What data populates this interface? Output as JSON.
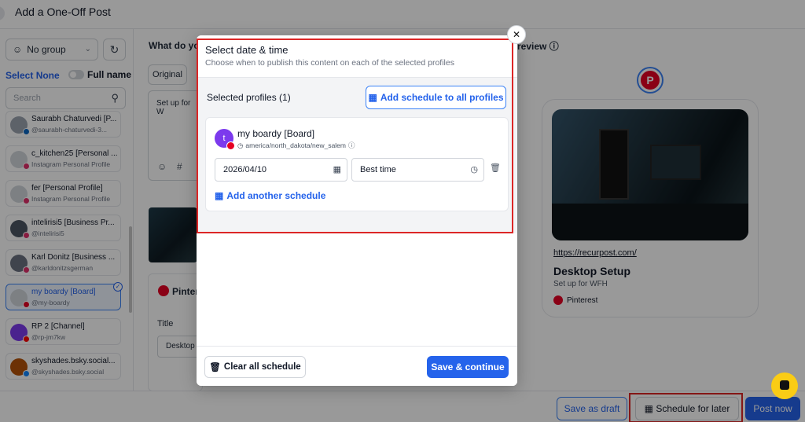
{
  "header": {
    "title": "Add a One-Off Post"
  },
  "sidebar": {
    "group_select": "No group",
    "select_none": "Select None",
    "full_name": "Full name",
    "search_placeholder": "Search",
    "profiles": [
      {
        "name": "Saurabh Chaturvedi [P...",
        "sub": "@saurabh-chaturvedi-3..."
      },
      {
        "name": "c_kitchen25 [Personal ...",
        "sub": "Instagram Personal Profile"
      },
      {
        "name": "fer [Personal Profile]",
        "sub": "Instagram Personal Profile"
      },
      {
        "name": "intelirisi5 [Business Pr...",
        "sub": "@intelirisi5"
      },
      {
        "name": "Karl Donitz [Business ...",
        "sub": "@karldonitzsgerman"
      },
      {
        "name": "my boardy [Board]",
        "sub": "@my-boardy"
      },
      {
        "name": "RP 2 [Channel]",
        "sub": "@rp-jm7kw"
      },
      {
        "name": "skyshades.bsky.social...",
        "sub": "@skyshades.bsky.social"
      }
    ]
  },
  "editor": {
    "label": "What do yo",
    "tab_original": "Original",
    "text_preview": "Set up for W",
    "pinterest_title": "Pintere",
    "title_label": "Title",
    "title_value": "Desktop"
  },
  "preview": {
    "label": "review",
    "link": "https://recurpost.com/",
    "title": "Desktop Setup",
    "description": "Set up for WFH",
    "network": "Pinterest"
  },
  "modal": {
    "title": "Select date & time",
    "subtitle": "Choose when to publish this content on each of the selected profiles",
    "selected_label": "Selected profiles (1)",
    "add_all_label": "Add schedule to all profiles",
    "profile_name": "my boardy [Board]",
    "timezone": "america/north_dakota/new_salem",
    "date": "2026/04/10",
    "time": "Best time",
    "add_another_label": "Add another schedule",
    "clear_label": "Clear all schedule",
    "save_label": "Save & continue"
  },
  "bottom_bar": {
    "draft_label": "Save as draft",
    "later_label": "Schedule for later",
    "post_label": "Post now"
  },
  "colors": {
    "accent": "#2563eb",
    "highlight": "#dc2626",
    "pinterest": "#e60023"
  }
}
